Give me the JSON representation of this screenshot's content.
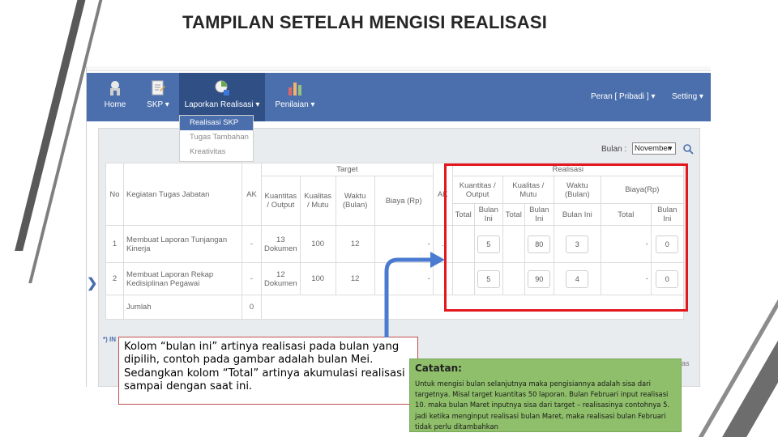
{
  "slide": {
    "title": "TAMPILAN SETELAH MENGISI REALISASI"
  },
  "colors": {
    "navbar": "#4b6fad",
    "navbar_active": "#2f4f85",
    "highlight": "#e3181f",
    "note_bg": "#8fbf6a"
  },
  "nav": {
    "home": "Home",
    "skp": "SKP ▾",
    "laporan": "Laporkan Realisasi ▾",
    "penilaian": "Penilaian ▾",
    "peran": "Peran [ Pribadi ] ▾",
    "setting": "Setting ▾",
    "icons": [
      "home-icon",
      "document-icon",
      "report-icon",
      "chart-icon"
    ]
  },
  "dropdown": {
    "items": [
      "Realisasi SKP",
      "Tugas Tambahan",
      "Kreativitas"
    ]
  },
  "filter": {
    "bulan_label": "Bulan :",
    "bulan_value": "November",
    "search_icon": "search-icon"
  },
  "table": {
    "group_target": "Target",
    "group_realisasi": "Realisasi",
    "headers": {
      "no": "No",
      "kegiatan": "Kegiatan Tugas Jabatan",
      "ak": "AK",
      "kuantitas": "Kuantitas / Output",
      "kualitas": "Kualitas / Mutu",
      "waktu": "Waktu (Bulan)",
      "biaya": "Biaya (Rp)",
      "ak_r": "AK",
      "r_kuantitas": "Kuantitas / Output",
      "r_kualitas": "Kualitas / Mutu",
      "r_waktu": "Waktu (Bulan)",
      "r_biaya": "Biaya(Rp)",
      "total": "Total",
      "bulan_ini": "Bulan Ini"
    },
    "rows": [
      {
        "no": "1",
        "kegiatan": "Membuat Laporan Tunjangan Kinerja",
        "ak": "-",
        "kuantitas": "13 Dokumen",
        "kualitas": "100",
        "waktu": "12",
        "biaya": "-",
        "ak_r": ".",
        "r_kuantitas": "5",
        "r_kualitas": "80",
        "r_waktu": "3",
        "r_biaya_total": "-",
        "r_biaya": "0"
      },
      {
        "no": "2",
        "kegiatan": "Membuat Laporan Rekap Kedisiplinan Pegawai",
        "ak": "-",
        "kuantitas": "12 Dokumen",
        "kualitas": "100",
        "waktu": "12",
        "biaya": "-",
        "ak_r": "",
        "r_kuantitas": "5",
        "r_kualitas": "90",
        "r_waktu": "4",
        "r_biaya_total": "-",
        "r_biaya": "0"
      }
    ],
    "jumlah_label": "Jumlah",
    "jumlah_ak": "0"
  },
  "footnote_stub": "*) IN",
  "button_stub_text": "as",
  "side_arrow": "❯",
  "callout_bulan": "Kolom “bulan ini” artinya realisasi pada bulan yang dipilih, contoh pada gambar adalah bulan Mei. Sedangkan kolom “Total” artinya akumulasi realisasi sampai dengan saat ini.",
  "catatan": {
    "title": "Catatan:",
    "body": "Untuk mengisi bulan selanjutnya maka pengisiannya adalah sisa dari targetnya. Misal target kuantitas 50 laporan. Bulan Februari input realisasi 10. maka bulan Maret inputnya sisa dari target – realisasinya contohnya 5. jadi ketika menginput realisasi bulan Maret, maka realisasi bulan Februari tidak perlu ditambahkan"
  }
}
